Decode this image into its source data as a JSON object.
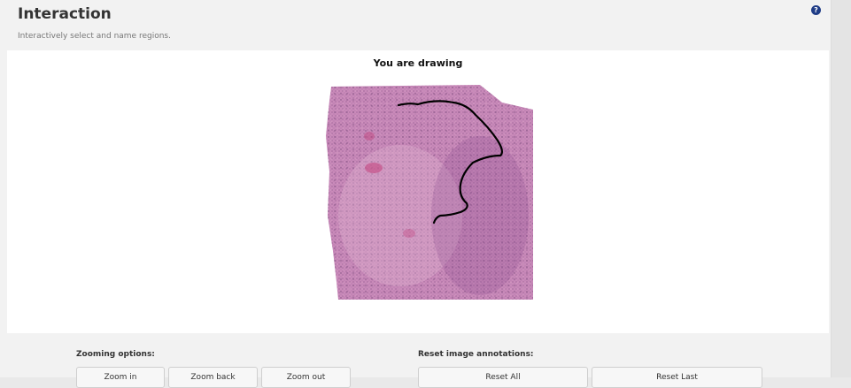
{
  "header": {
    "title": "Interaction",
    "subtitle": "Interactively select and name regions.",
    "help_icon": "question-circle-icon"
  },
  "canvas": {
    "title": "You are drawing"
  },
  "zoom": {
    "label": "Zooming options:",
    "buttons": [
      "Zoom in",
      "Zoom back",
      "Zoom out"
    ]
  },
  "reset": {
    "label": "Reset image annotations:",
    "buttons": [
      "Reset All",
      "Reset Last"
    ]
  },
  "colors": {
    "help_icon": "#1f3c86",
    "drawn_path": "#000000",
    "tissue": "#c98ab9"
  }
}
